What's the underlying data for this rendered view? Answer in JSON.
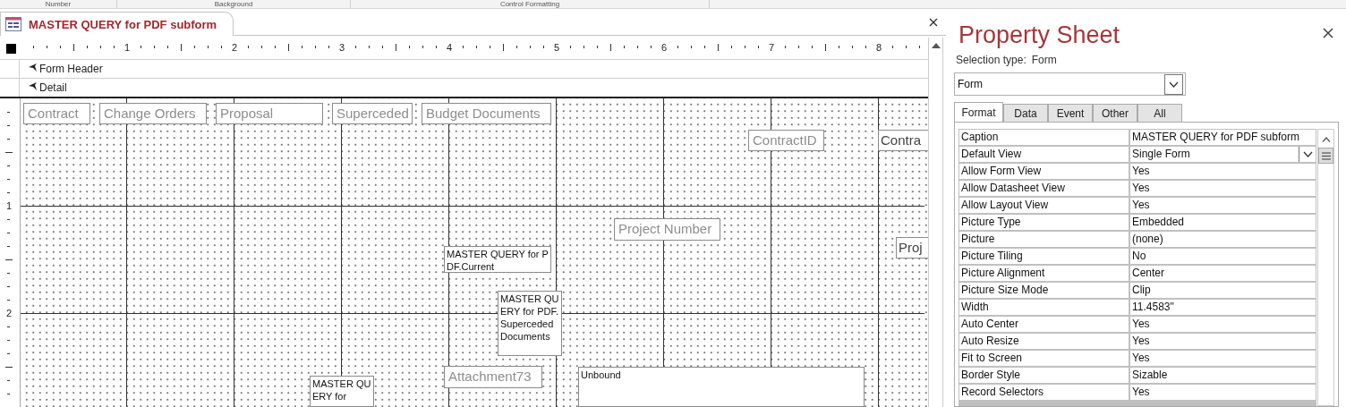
{
  "ribbon_groups": [
    "Number",
    "Background",
    "Control Formatting"
  ],
  "document_tab": {
    "title": "MASTER QUERY for PDF subform"
  },
  "ruler": {
    "labels": [
      "1",
      "2",
      "3",
      "4",
      "5",
      "6",
      "7",
      "8"
    ]
  },
  "vertical_ruler": {
    "labels": [
      "1",
      "2"
    ]
  },
  "sections": [
    {
      "label": "Form Header"
    },
    {
      "label": "Detail"
    }
  ],
  "controls": [
    {
      "kind": "label",
      "text": "Contract"
    },
    {
      "kind": "label",
      "text": "Change Orders"
    },
    {
      "kind": "label",
      "text": "Proposal"
    },
    {
      "kind": "label",
      "text": "Superceded"
    },
    {
      "kind": "label",
      "text": "Budget Documents"
    },
    {
      "kind": "label",
      "text": "ContractID"
    },
    {
      "kind": "field",
      "text": "Contra"
    },
    {
      "kind": "label",
      "text": "Project Number"
    },
    {
      "kind": "field",
      "text": "Proj"
    },
    {
      "kind": "textbox",
      "text": "MASTER QUERY for PDF.Current"
    },
    {
      "kind": "textbox",
      "text": "MASTER QUERY for PDF.Superceded Documents"
    },
    {
      "kind": "label",
      "text": "Attachment73"
    },
    {
      "kind": "textbox",
      "text": "Unbound"
    },
    {
      "kind": "textbox",
      "text": "MASTER QUERY for"
    }
  ],
  "property_sheet": {
    "title": "Property Sheet",
    "selection_label": "Selection type:",
    "selection_type": "Form",
    "object_select": "Form",
    "tabs": [
      {
        "label": "Format",
        "selected": true
      },
      {
        "label": "Data",
        "selected": false
      },
      {
        "label": "Event",
        "selected": false
      },
      {
        "label": "Other",
        "selected": false
      },
      {
        "label": "All",
        "selected": false
      }
    ],
    "properties": [
      {
        "name": "Caption",
        "value": "MASTER QUERY for PDF subform",
        "kind": "text"
      },
      {
        "name": "Default View",
        "value": "Single Form",
        "kind": "dropdown"
      },
      {
        "name": "Allow Form View",
        "value": "Yes",
        "kind": "text"
      },
      {
        "name": "Allow Datasheet View",
        "value": "Yes",
        "kind": "text"
      },
      {
        "name": "Allow Layout View",
        "value": "Yes",
        "kind": "text"
      },
      {
        "name": "Picture Type",
        "value": "Embedded",
        "kind": "text"
      },
      {
        "name": "Picture",
        "value": "(none)",
        "kind": "text"
      },
      {
        "name": "Picture Tiling",
        "value": "No",
        "kind": "text"
      },
      {
        "name": "Picture Alignment",
        "value": "Center",
        "kind": "text"
      },
      {
        "name": "Picture Size Mode",
        "value": "Clip",
        "kind": "text"
      },
      {
        "name": "Width",
        "value": "11.4583\"",
        "kind": "text"
      },
      {
        "name": "Auto Center",
        "value": "Yes",
        "kind": "text"
      },
      {
        "name": "Auto Resize",
        "value": "Yes",
        "kind": "text"
      },
      {
        "name": "Fit to Screen",
        "value": "Yes",
        "kind": "text"
      },
      {
        "name": "Border Style",
        "value": "Sizable",
        "kind": "text"
      },
      {
        "name": "Record Selectors",
        "value": "Yes",
        "kind": "text"
      }
    ]
  }
}
